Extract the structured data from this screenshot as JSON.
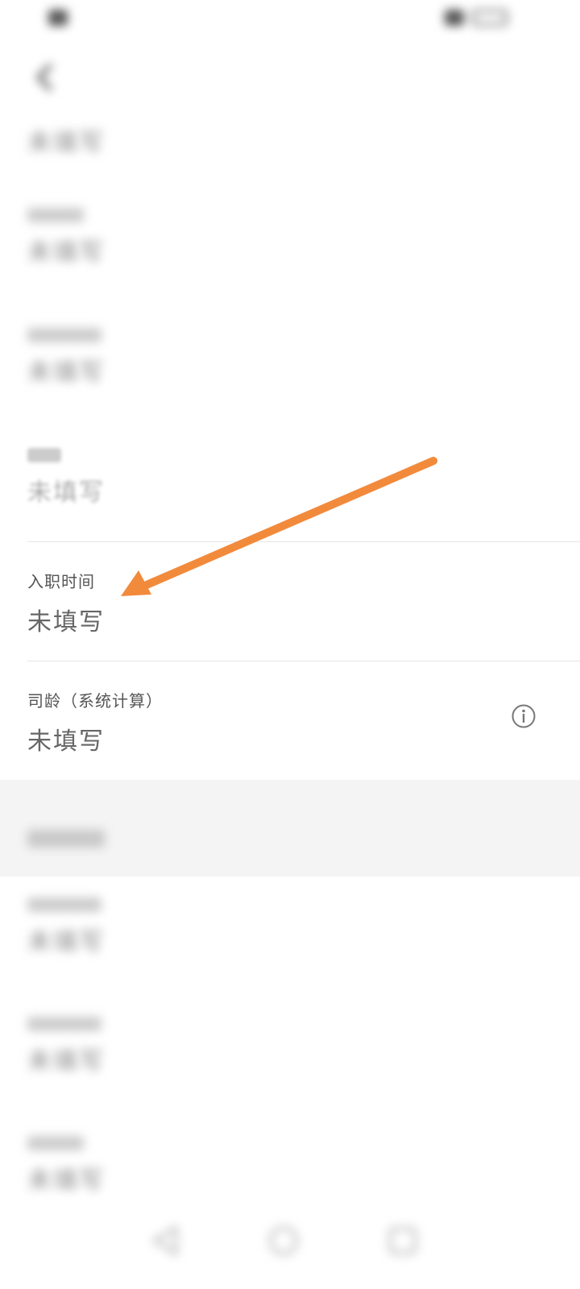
{
  "status_bar": {
    "left_text": "",
    "right_text": ""
  },
  "nav": {
    "title": "",
    "action_label": ""
  },
  "fields": {
    "f1_value": "未填写",
    "f2_value": "未填写",
    "f3_value": "未填写",
    "f4_value": "未填写",
    "hire_date_label": "入职时间",
    "hire_date_value": "未填写",
    "seniority_label": "司龄（系统计算）",
    "seniority_value": "未填写",
    "f7_value": "未填写",
    "f8_value": "未填写",
    "f9_value": "未填写"
  },
  "section": {
    "title": ""
  },
  "colors": {
    "annotation_arrow": "#f28a3c",
    "divider": "#e6e6e6"
  },
  "icons": {
    "back": "chevron-left-icon",
    "info": "info-circle-icon",
    "annotation": "arrow-annotation-icon"
  }
}
